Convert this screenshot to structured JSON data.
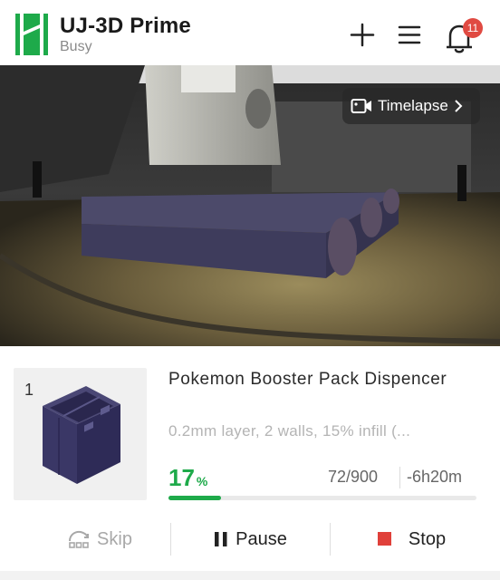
{
  "header": {
    "title": "UJ-3D Prime",
    "status": "Busy",
    "notification_count": "11",
    "logo_icon": "brand-logo-icon",
    "icons": [
      "plus-icon",
      "menu-icon",
      "bell-icon"
    ]
  },
  "camera": {
    "timelapse_label": "Timelapse"
  },
  "job": {
    "plate_number": "1",
    "name": "Pokemon Booster Pack Dispencer",
    "settings": "0.2mm layer, 2 walls, 15% infill (...",
    "percent": "17",
    "percent_unit": "%",
    "progress_fraction": 0.17,
    "layers": "72/900",
    "eta": "-6h20m"
  },
  "actions": {
    "skip": "Skip",
    "pause": "Pause",
    "stop": "Stop"
  },
  "colors": {
    "brand_green": "#1eaa4a",
    "badge_red": "#e04a42",
    "stop_red": "#e0403a"
  }
}
